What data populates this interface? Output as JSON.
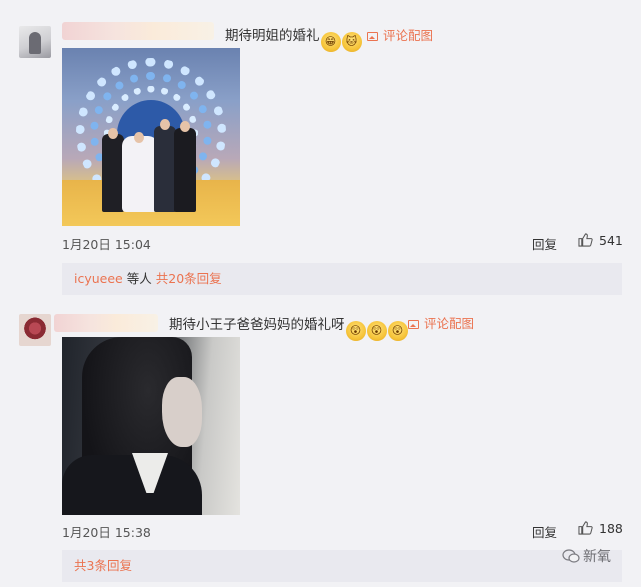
{
  "comments": [
    {
      "text": "期待明姐的婚礼",
      "emojis": [
        "grin",
        "cat"
      ],
      "pic_link": "评论配图",
      "time": "1月20日 15:04",
      "reply_label": "回复",
      "likes": "541",
      "sub_user": "icyueee",
      "sub_mid": "等人",
      "sub_link": "共20条回复"
    },
    {
      "text": "期待小王子爸爸妈妈的婚礼呀",
      "emojis": [
        "shocked",
        "shocked",
        "shocked"
      ],
      "pic_link": "评论配图",
      "time": "1月20日 15:38",
      "reply_label": "回复",
      "likes": "188",
      "sub_link": "共3条回复"
    }
  ],
  "watermark": "新氧",
  "colors": {
    "accent": "#eb7350",
    "background": "#f2f2f5",
    "sub_box": "#e9e9ef"
  }
}
